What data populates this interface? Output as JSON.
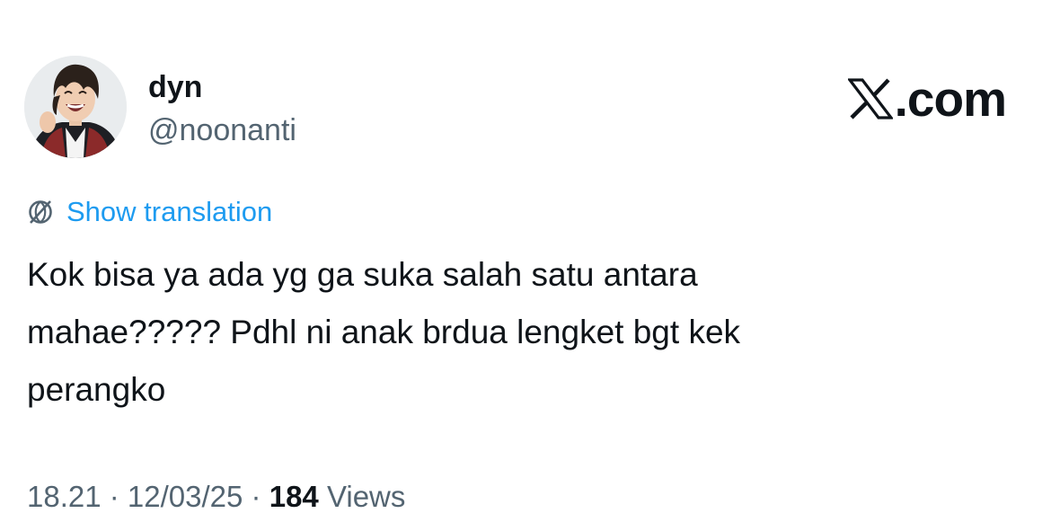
{
  "author": {
    "display_name": "dyn",
    "handle": "@noonanti",
    "avatar_icon": "profile-photo"
  },
  "brand": {
    "logo_icon": "x-logo-icon",
    "text": ".com"
  },
  "translation": {
    "icon": "globe-icon",
    "label": "Show translation",
    "color": "#1d9bf0"
  },
  "tweet": {
    "lines": [
      "Kok bisa ya ada yg ga suka salah satu antara",
      "mahae????? Pdhl ni anak brdua lengket bgt kek",
      "perangko"
    ]
  },
  "meta": {
    "time": "18.21",
    "sep1": " · ",
    "date": "12/03/25",
    "sep2": " · ",
    "views_count": "184",
    "views_label": " Views"
  },
  "colors": {
    "text_primary": "#0f1419",
    "text_secondary": "#536471",
    "link": "#1d9bf0",
    "background": "#ffffff"
  }
}
